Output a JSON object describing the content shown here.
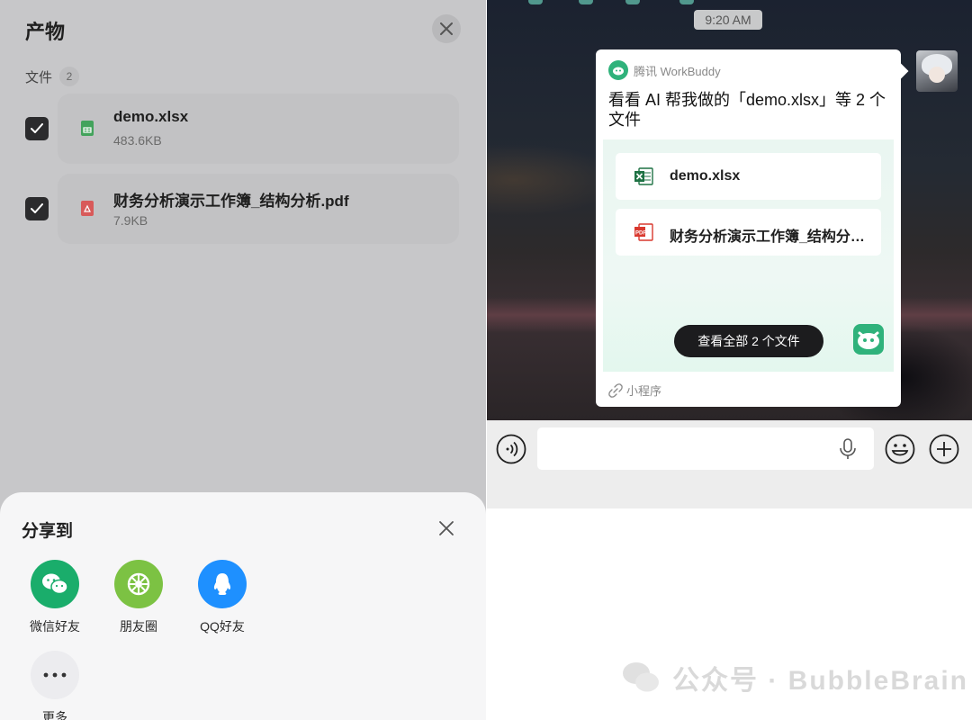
{
  "left_panel": {
    "title": "产物",
    "section_label": "文件",
    "section_count": "2",
    "files": [
      {
        "name": "demo.xlsx",
        "size": "483.6KB",
        "type": "xlsx",
        "checked": true
      },
      {
        "name": "财务分析演示工作簿_结构分析.pdf",
        "size": "7.9KB",
        "type": "pdf",
        "checked": true
      }
    ],
    "share_sheet": {
      "title": "分享到",
      "items": [
        {
          "label": "微信好友",
          "icon": "wechat-icon",
          "color": "#1aad6b"
        },
        {
          "label": "朋友圈",
          "icon": "moments-icon",
          "color": "#7cc243"
        },
        {
          "label": "QQ好友",
          "icon": "qq-icon",
          "color": "#1e90ff"
        },
        {
          "label": "更多",
          "icon": "more-icon",
          "color": "#ececef"
        }
      ]
    }
  },
  "chat": {
    "timestamp": "9:20 AM",
    "mini_program_card": {
      "brand": "腾讯 WorkBuddy",
      "title": "看看 AI 帮我做的「demo.xlsx」等 2 个文件",
      "files": [
        {
          "name": "demo.xlsx",
          "type": "excel"
        },
        {
          "name": "财务分析演示工作簿_结构分析.pdf",
          "type": "pdf"
        }
      ],
      "view_all_label": "查看全部 2 个文件",
      "footer": "小程序"
    },
    "input_bar": {
      "value": ""
    }
  },
  "watermark": {
    "text": "公众号 · BubbleBrain"
  },
  "colors": {
    "accent_green": "#2fb27b",
    "excel_green": "#1f7244",
    "pdf_red": "#d9382e"
  }
}
